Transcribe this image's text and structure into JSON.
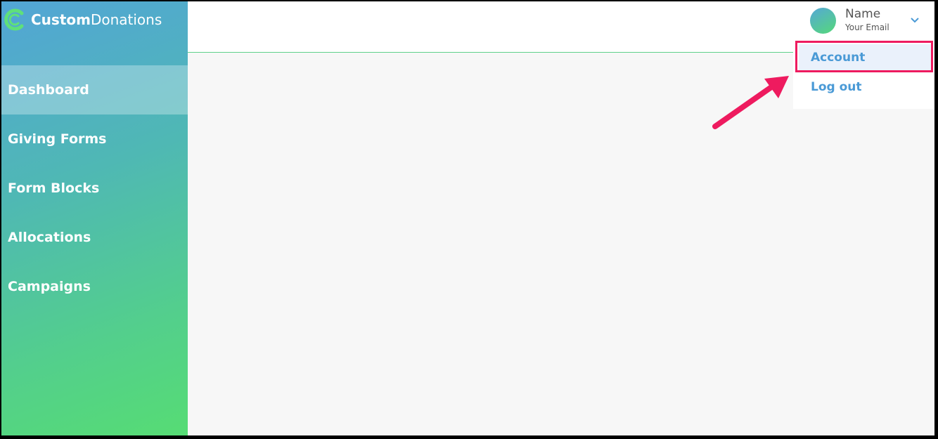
{
  "app": {
    "logo_bold": "Custom",
    "logo_light": "Donations"
  },
  "sidebar": {
    "items": [
      {
        "label": "Dashboard",
        "active": true
      },
      {
        "label": "Giving Forms",
        "active": false
      },
      {
        "label": "Form Blocks",
        "active": false
      },
      {
        "label": "Allocations",
        "active": false
      },
      {
        "label": "Campaigns",
        "active": false
      }
    ]
  },
  "user": {
    "name": "Name",
    "email": "Your Email"
  },
  "dropdown": {
    "items": [
      {
        "label": "Account",
        "highlighted": true
      },
      {
        "label": "Log out",
        "highlighted": false
      }
    ]
  },
  "colors": {
    "accent": "#4a9ad6",
    "annotation": "#ee1b5f",
    "topbar_border": "#5fd08a"
  }
}
